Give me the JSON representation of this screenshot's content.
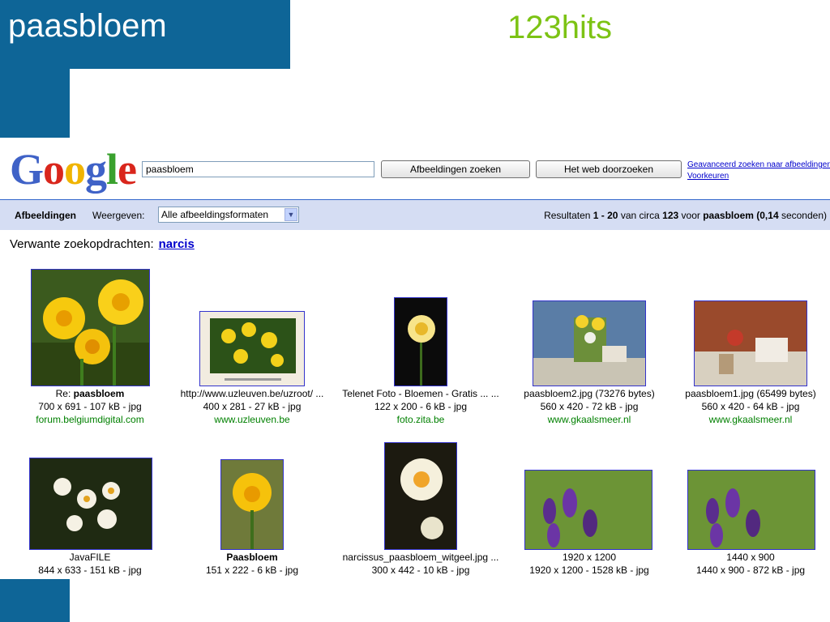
{
  "slide": {
    "title": "paasbloem",
    "hits": "123hits"
  },
  "google": {
    "logo": [
      "G",
      "o",
      "o",
      "g",
      "l",
      "e"
    ],
    "logo_colors": [
      "#3f62c7",
      "#d9261c",
      "#f0b400",
      "#3f62c7",
      "#3aa12e",
      "#d9261c"
    ],
    "search_value": "paasbloem",
    "btn_images": "Afbeeldingen zoeken",
    "btn_web": "Het web doorzoeken",
    "link_advanced": "Geavanceerd zoeken naar afbeeldingen",
    "link_prefs": "Voorkeuren",
    "bar_label": "Afbeeldingen",
    "bar_view": "Weergeven:",
    "select_value": "Alle afbeeldingsformaten",
    "results": {
      "pre": "Resultaten ",
      "range": "1 - 20",
      "mid1": " van circa ",
      "count": "123",
      "mid2": " voor ",
      "query": "paasbloem",
      "time": "(0,14",
      "post": " seconden)"
    },
    "related_label": "Verwante zoekopdrachten:",
    "related_link": "narcis"
  },
  "results": [
    {
      "line1_pre": "Re: ",
      "line1_bold": "paasbloem",
      "line2": "700 x 691 - 107 kB - jpg",
      "line3": "forum.belgiumdigital.com"
    },
    {
      "line1_pre": "http://www.uzleuven.be/uzroot/ ...",
      "line1_bold": "",
      "line2": "400 x 281 - 27 kB - jpg",
      "line3": "www.uzleuven.be"
    },
    {
      "line1_pre": "Telenet Foto - Bloemen - Gratis ... ...",
      "line1_bold": "",
      "line2": "122 x 200 - 6 kB - jpg",
      "line3": "foto.zita.be"
    },
    {
      "line1_pre": "paasbloem2.jpg (73276 bytes)",
      "line1_bold": "",
      "line2": "560 x 420 - 72 kB - jpg",
      "line3": "www.gkaalsmeer.nl"
    },
    {
      "line1_pre": "paasbloem1.jpg (65499 bytes)",
      "line1_bold": "",
      "line2": "560 x 420 - 64 kB - jpg",
      "line3": "www.gkaalsmeer.nl"
    },
    {
      "line1_pre": "JavaFILE",
      "line1_bold": "",
      "line2": "844 x 633 - 151 kB - jpg",
      "line3": ""
    },
    {
      "line1_pre": "",
      "line1_bold": "Paasbloem",
      "line2": "151 x 222 - 6 kB - jpg",
      "line3": ""
    },
    {
      "line1_pre": "narcissus_paasbloem_witgeel.jpg ...",
      "line1_bold": "",
      "line2": "300 x 442 - 10 kB - jpg",
      "line3": ""
    },
    {
      "line1_pre": "1920 x 1200",
      "line1_bold": "",
      "line2": "1920 x 1200 - 1528 kB - jpg",
      "line3": ""
    },
    {
      "line1_pre": "1440 x 900",
      "line1_bold": "",
      "line2": "1440 x 900 - 872 kB - jpg",
      "line3": ""
    }
  ]
}
